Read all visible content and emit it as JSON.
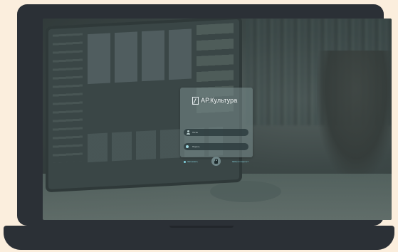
{
  "app": {
    "brand_name": "АР.Культура",
    "logo_icon": "document-pen-icon"
  },
  "login_form": {
    "login_placeholder": "Логин",
    "password_placeholder": "Пароль",
    "remember_label": "Запомнить",
    "forgot_link": "Забыли пароль?",
    "submit_icon": "lock-icon"
  },
  "colors": {
    "background": "#fbeedd",
    "device": "#2b3036",
    "accent": "#86d3de"
  }
}
